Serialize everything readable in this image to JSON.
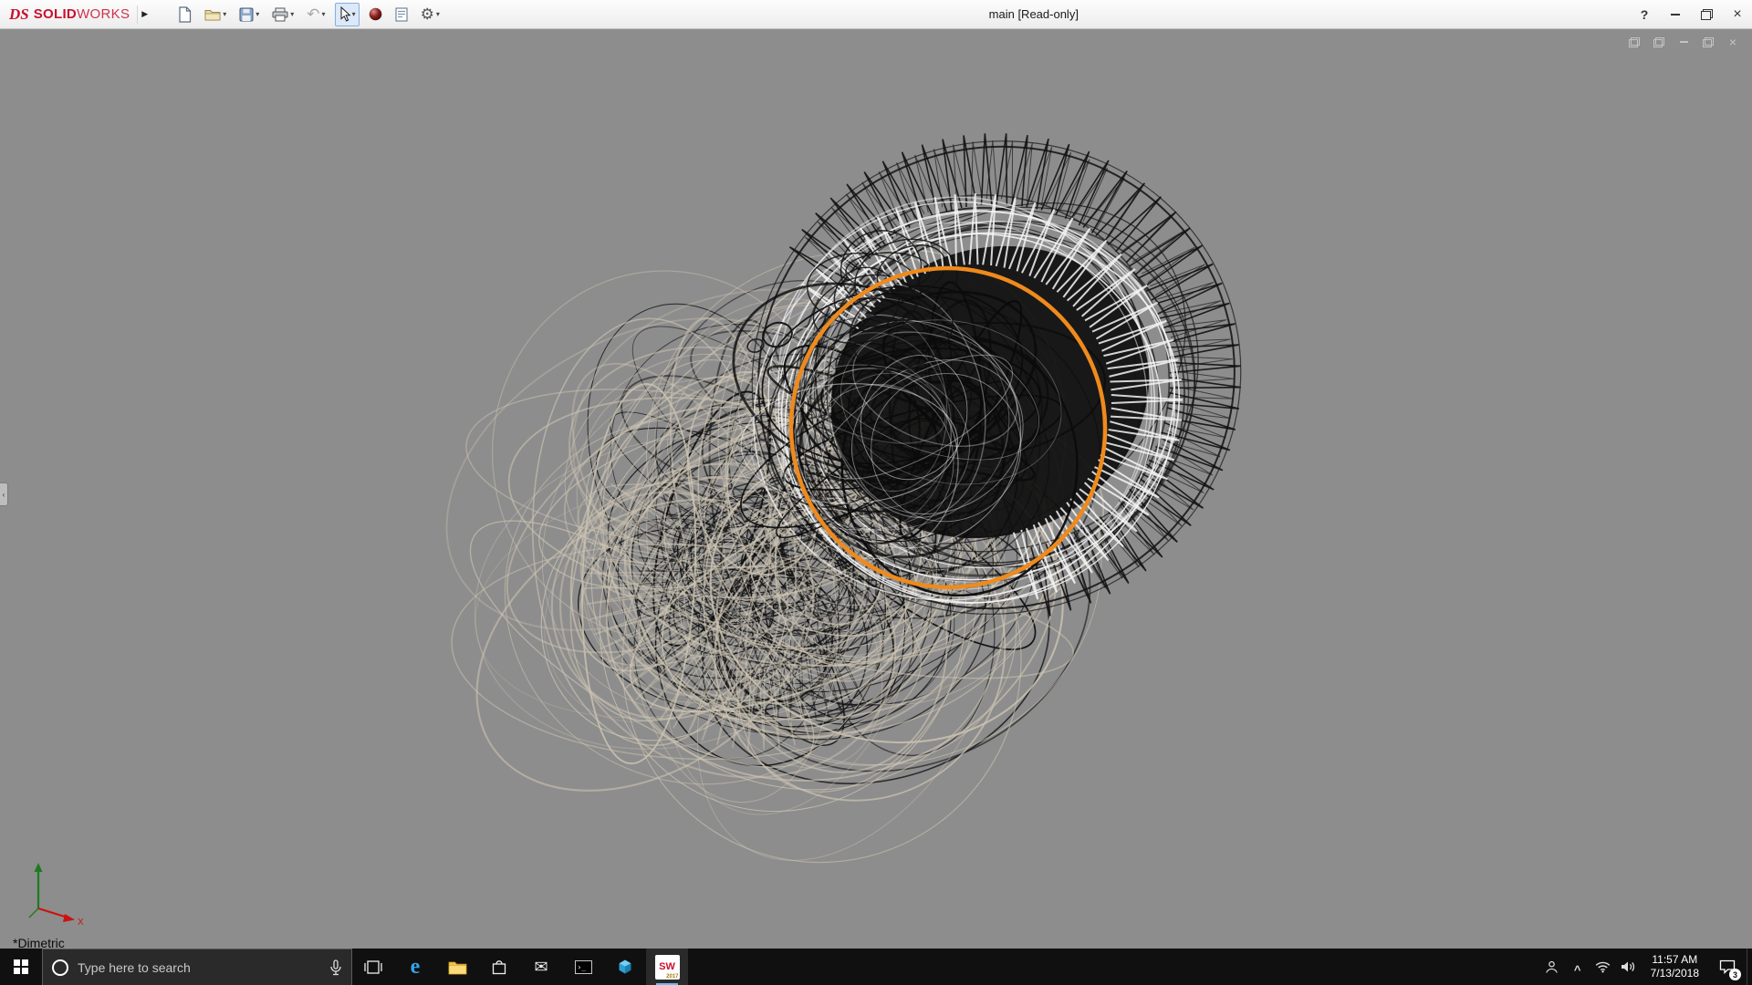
{
  "colors": {
    "accent_orange": "#EF8A1C",
    "viewport_bg": "#8d8d8d",
    "tan": "#cdc4b2",
    "wire_black": "#121212",
    "wire_white": "#f6f6f6",
    "solidworks_red": "#c8102e",
    "taskbar_bg": "#101010"
  },
  "titlebar": {
    "logo_mark": "DS",
    "logo_solid": "SOLID",
    "logo_works": "WORKS",
    "document_title": "main [Read-only]",
    "help_glyph": "?",
    "glyphs": {
      "flyout": "▶",
      "caret": "▾",
      "undo": "↶",
      "gear": "⚙",
      "close": "×"
    }
  },
  "viewport": {
    "view_label": "*Dimetric",
    "ghost_close": "×",
    "panel_tab_glyph": "‹"
  },
  "taskbar": {
    "search_placeholder": "Type here to search",
    "edge_glyph": "e",
    "cmd_glyph": "›_",
    "solidworks_label": "SW",
    "solidworks_year": "2017",
    "chevron_glyph": "^",
    "mail_glyph": "✉",
    "tray": {
      "time": "11:57 AM",
      "date": "7/13/2018",
      "notification_count": "3"
    }
  }
}
